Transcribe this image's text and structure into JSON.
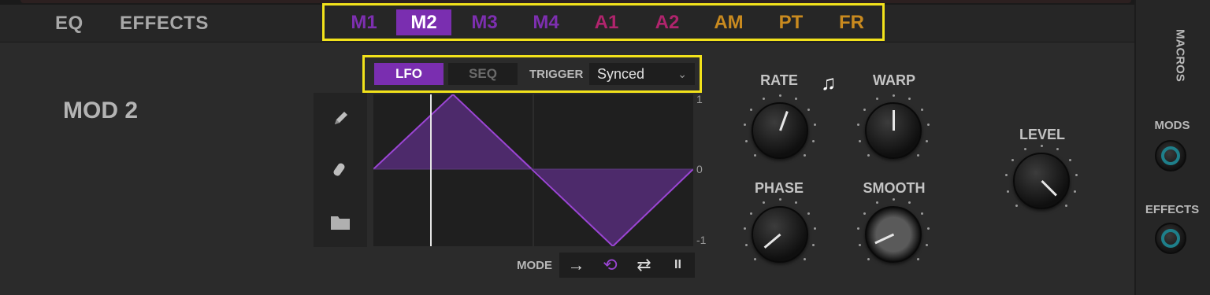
{
  "top_tabs": [
    "EQ",
    "EFFECTS"
  ],
  "mod_tabs": [
    {
      "label": "M1",
      "color": "#7d2fb0",
      "active": false
    },
    {
      "label": "M2",
      "color": "#ffffff",
      "active": true
    },
    {
      "label": "M3",
      "color": "#7d2fb0",
      "active": false
    },
    {
      "label": "M4",
      "color": "#7d2fb0",
      "active": false
    },
    {
      "label": "A1",
      "color": "#b0246d",
      "active": false
    },
    {
      "label": "A2",
      "color": "#b0246d",
      "active": false
    },
    {
      "label": "AM",
      "color": "#c98a1f",
      "active": false
    },
    {
      "label": "PT",
      "color": "#c98a1f",
      "active": false
    },
    {
      "label": "FR",
      "color": "#c98a1f",
      "active": false
    }
  ],
  "panel": {
    "title": "MOD 2",
    "lfo_label": "LFO",
    "seq_label": "SEQ",
    "trigger_label": "TRIGGER",
    "trigger_value": "Synced",
    "scale": {
      "top": "1",
      "mid": "0",
      "bottom": "-1"
    },
    "mode_label": "MODE",
    "mode_buttons": [
      {
        "icon": "one-shot-arrow-icon",
        "glyph": "→",
        "active": false
      },
      {
        "icon": "loop-icon",
        "glyph": "⟲",
        "active": true
      },
      {
        "icon": "ping-pong-icon",
        "glyph": "⇄",
        "active": false
      },
      {
        "icon": "pause-icon",
        "glyph": "II",
        "active": false
      }
    ],
    "knobs": {
      "rate": "RATE",
      "warp": "WARP",
      "phase": "PHASE",
      "smooth": "SMOOTH",
      "level": "LEVEL"
    }
  },
  "sidebar": {
    "macros": "MACROS",
    "mods": "MODS",
    "effects": "EFFECTS"
  },
  "colors": {
    "accent": "#7a2eb0",
    "highlight": "#f2e21b",
    "mod_knob": "#1e7f8a"
  }
}
